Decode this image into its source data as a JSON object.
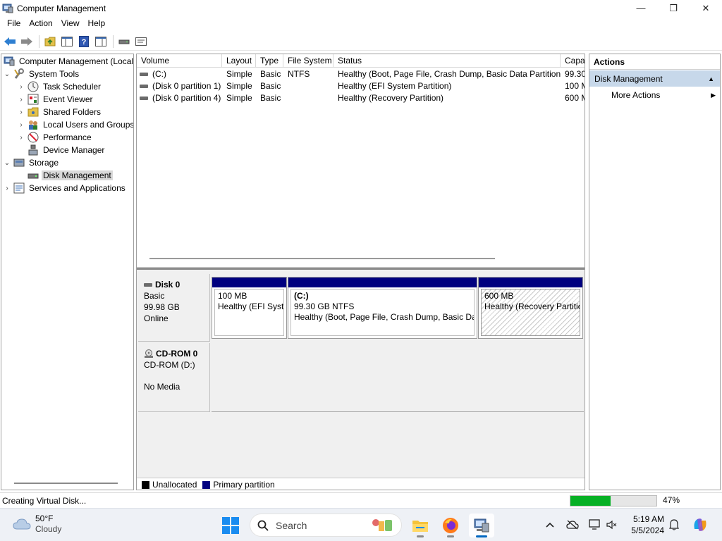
{
  "window": {
    "title": "Computer Management",
    "minimize_glyph": "—",
    "maximize_glyph": "❐",
    "close_glyph": "✕"
  },
  "menu": [
    "File",
    "Action",
    "View",
    "Help"
  ],
  "toolbar": {
    "icons": [
      "back-icon",
      "forward-icon",
      "up-folder-icon",
      "show-hide-tree-icon",
      "help-icon",
      "show-hide-action-pane-icon",
      "drive-icon",
      "properties-icon"
    ]
  },
  "tree": {
    "root": "Computer Management (Local",
    "system_tools": "System Tools",
    "task_scheduler": "Task Scheduler",
    "event_viewer": "Event Viewer",
    "shared_folders": "Shared Folders",
    "local_users": "Local Users and Groups",
    "performance": "Performance",
    "device_manager": "Device Manager",
    "storage": "Storage",
    "disk_management": "Disk Management",
    "services": "Services and Applications"
  },
  "volumes": {
    "headers": [
      "Volume",
      "Layout",
      "Type",
      "File System",
      "Status",
      "Capa"
    ],
    "rows": [
      {
        "volume": "(C:)",
        "layout": "Simple",
        "type": "Basic",
        "fs": "NTFS",
        "status": "Healthy (Boot, Page File, Crash Dump, Basic Data Partition)",
        "capacity": "99.30"
      },
      {
        "volume": "(Disk 0 partition 1)",
        "layout": "Simple",
        "type": "Basic",
        "fs": "",
        "status": "Healthy (EFI System Partition)",
        "capacity": "100 M"
      },
      {
        "volume": "(Disk 0 partition 4)",
        "layout": "Simple",
        "type": "Basic",
        "fs": "",
        "status": "Healthy (Recovery Partition)",
        "capacity": "600 M"
      }
    ]
  },
  "disks": {
    "disk0": {
      "name": "Disk 0",
      "kind": "Basic",
      "size": "99.98 GB",
      "state": "Online",
      "partitions": [
        {
          "title": "",
          "size": "100 MB",
          "status": "Healthy (EFI Syste"
        },
        {
          "title": "(C:)",
          "size": "99.30 GB NTFS",
          "status": "Healthy (Boot, Page File, Crash Dump, Basic Data"
        },
        {
          "title": "",
          "size": "600 MB",
          "status": "Healthy (Recovery Partitic"
        }
      ]
    },
    "cdrom": {
      "name": "CD-ROM 0",
      "kind": "CD-ROM (D:)",
      "media": "No Media"
    }
  },
  "legend": {
    "unallocated": "Unallocated",
    "primary": "Primary partition",
    "unallocated_color": "#000000",
    "primary_color": "#00007f"
  },
  "actions": {
    "header": "Actions",
    "section": "Disk Management",
    "more": "More Actions"
  },
  "status": {
    "text": "Creating Virtual Disk...",
    "progress": 0.47,
    "progress_label": "47%",
    "progress_color": "#06b025"
  },
  "taskbar": {
    "weather_temp": "50°F",
    "weather_desc": "Cloudy",
    "search_placeholder": "Search",
    "time": "5:19 AM",
    "date": "5/5/2024"
  }
}
